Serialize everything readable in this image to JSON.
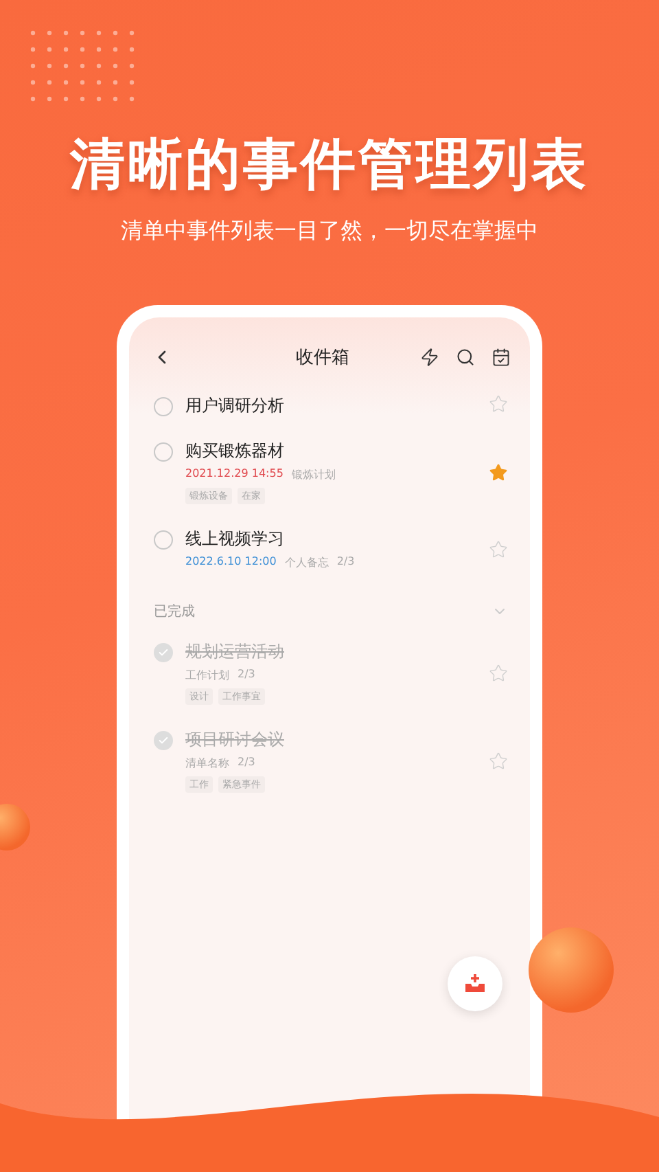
{
  "headline": "清晰的事件管理列表",
  "subtitle": "清单中事件列表一目了然，一切尽在掌握中",
  "app": {
    "title": "收件箱",
    "tasks": [
      {
        "title": "用户调研分析",
        "checked": false,
        "starred": false
      },
      {
        "title": "购买锻炼器材",
        "checked": false,
        "starred": true,
        "date": "2021.12.29 14:55",
        "color": "#e0474c",
        "list": "锻炼计划",
        "tags": [
          "锻炼设备",
          "在家"
        ]
      },
      {
        "title": "线上视频学习",
        "checked": false,
        "starred": false,
        "date": "2022.6.10 12:00",
        "color": "#3d8fd6",
        "list": "个人备忘",
        "progress": "2/3"
      }
    ],
    "done_section": {
      "label": "已完成",
      "expanded": true,
      "tasks": [
        {
          "title": "规划运营活动",
          "checked": true,
          "starred": false,
          "list": "工作计划",
          "progress": "2/3",
          "tags": [
            "设计",
            "工作事宜"
          ]
        },
        {
          "title": "项目研讨会议",
          "checked": true,
          "starred": false,
          "list": "清单名称",
          "progress": "2/3",
          "tags": [
            "工作",
            "紧急事件"
          ]
        }
      ]
    }
  }
}
